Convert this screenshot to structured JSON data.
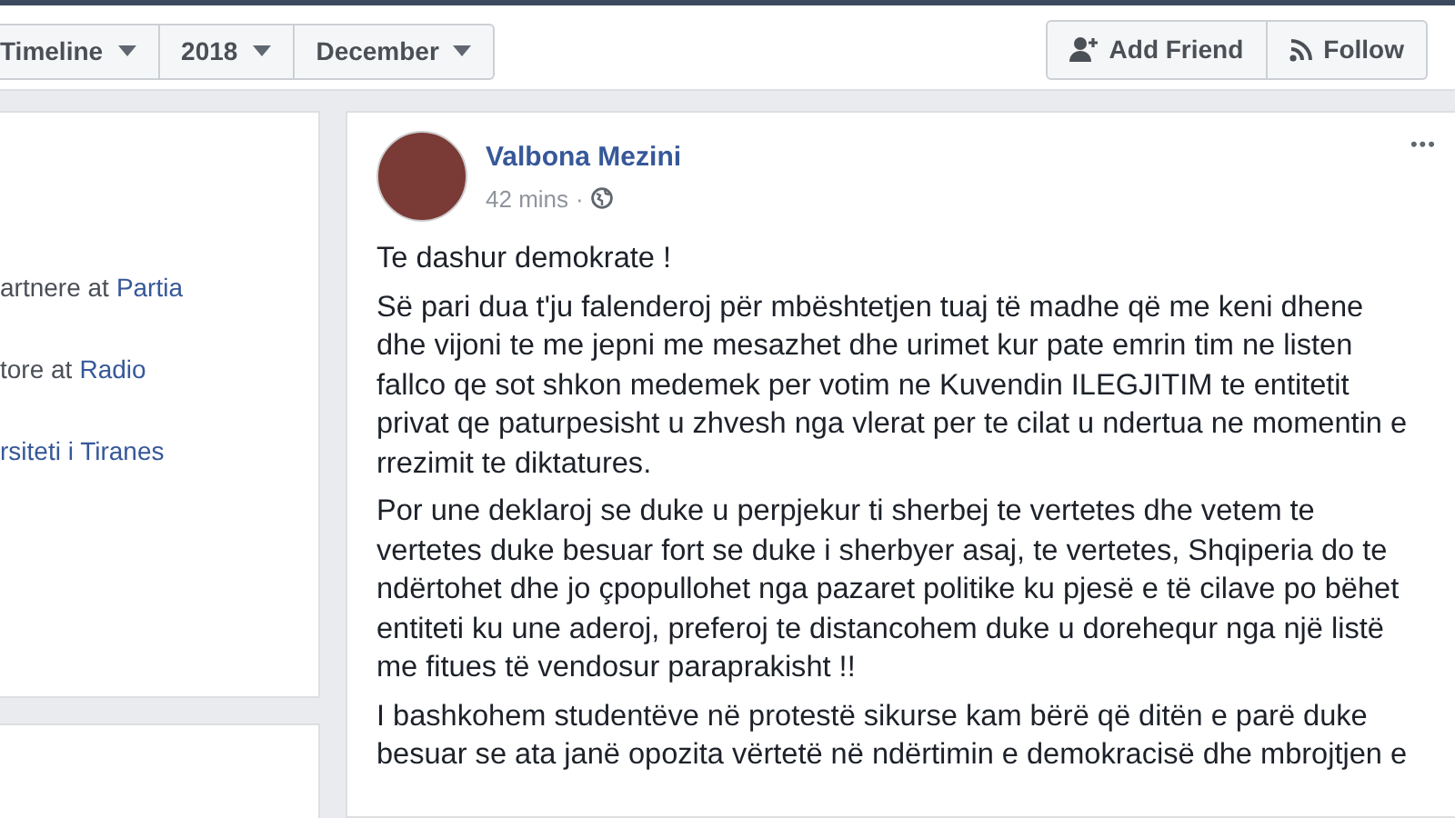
{
  "filters": [
    {
      "label": "Timeline"
    },
    {
      "label": "2018"
    },
    {
      "label": "December"
    }
  ],
  "profile_actions": [
    {
      "kind": "add-friend",
      "label": "Add Friend"
    },
    {
      "kind": "follow",
      "label": "Follow"
    }
  ],
  "intro": [
    {
      "text": "artnere at",
      "link": "Partia"
    },
    {
      "text": "tore at",
      "link": "Radio"
    },
    {
      "link": "rsiteti i Tiranes"
    }
  ],
  "post": {
    "author": "Valbona Mezini",
    "time": "42 mins",
    "separator": "·",
    "more": "•••",
    "paragraphs": [
      [
        "Te dashur demokrate !"
      ],
      [
        "Së pari dua t'ju falenderoj për mbështetjen tuaj të madhe që me keni dhene",
        "dhe vijoni te me jepni me mesazhet dhe urimet kur pate emrin tim ne listen",
        "fallco qe sot shkon medemek per votim ne Kuvendin ILEGJITIM te entitetit",
        "privat qe paturpesisht u zhvesh nga vlerat per te cilat u ndertua ne momentin e",
        "rrezimit te diktatures."
      ],
      [
        "Por une deklaroj se duke u perpjekur ti sherbej te vertetes dhe vetem te",
        "vertetes duke besuar fort se duke i sherbyer asaj, te vertetes, Shqiperia do te",
        "ndërtohet dhe jo çpopullohet nga pazaret politike ku pjesë e të cilave po bëhet",
        "entiteti ku une aderoj, preferoj te distancohem duke u dorehequr nga një listë",
        "me fitues të vendosur paraprakisht !!"
      ],
      [
        "I bashkohem studentëve në protestë sikurse kam bërë që ditën e parë duke",
        "besuar se ata janë opozita vërtetë në ndërtimin e demokracisë dhe mbrojtjen e"
      ]
    ]
  }
}
